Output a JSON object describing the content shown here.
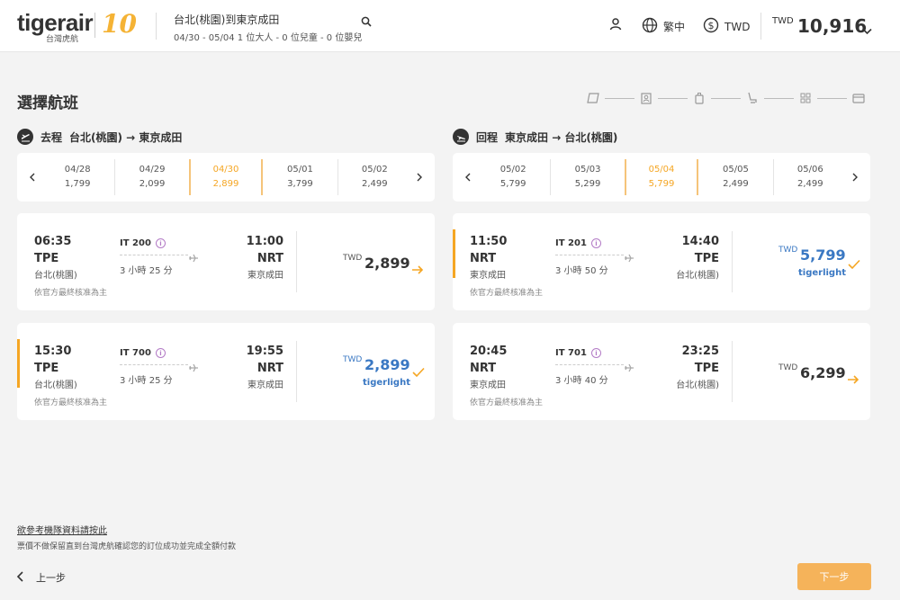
{
  "header": {
    "logo_text": "tigerair",
    "logo_sub": "台灣虎航",
    "logo_badge": "10",
    "route_title": "台北(桃園)到東京成田",
    "route_sub": "04/30 - 05/04   1 位大人 - 0 位兒童 - 0 位嬰兒",
    "language": "繁中",
    "currency": "TWD",
    "total_currency": "TWD",
    "total_amount": "10,916"
  },
  "page": {
    "title": "選擇航班"
  },
  "outbound": {
    "label": "去程",
    "route": "台北(桃園) → 東京成田",
    "dates": [
      {
        "date": "04/28",
        "price": "1,799"
      },
      {
        "date": "04/29",
        "price": "2,099"
      },
      {
        "date": "04/30",
        "price": "2,899"
      },
      {
        "date": "05/01",
        "price": "3,799"
      },
      {
        "date": "05/02",
        "price": "2,499"
      }
    ],
    "flights": [
      {
        "dep_time": "06:35",
        "dep_code": "TPE",
        "dep_city": "台北(桃園)",
        "flight_no": "IT 200",
        "duration": "3 小時 25 分",
        "arr_time": "11:00",
        "arr_code": "NRT",
        "arr_city": "東京成田",
        "note": "依官方最終核准為主",
        "currency": "TWD",
        "price": "2,899",
        "tier": ""
      },
      {
        "dep_time": "15:30",
        "dep_code": "TPE",
        "dep_city": "台北(桃園)",
        "flight_no": "IT 700",
        "duration": "3 小時 25 分",
        "arr_time": "19:55",
        "arr_code": "NRT",
        "arr_city": "東京成田",
        "note": "依官方最終核准為主",
        "currency": "TWD",
        "price": "2,899",
        "tier": "tigerlight"
      }
    ]
  },
  "inbound": {
    "label": "回程",
    "route": "東京成田 → 台北(桃園)",
    "dates": [
      {
        "date": "05/02",
        "price": "5,799"
      },
      {
        "date": "05/03",
        "price": "5,299"
      },
      {
        "date": "05/04",
        "price": "5,799"
      },
      {
        "date": "05/05",
        "price": "2,499"
      },
      {
        "date": "05/06",
        "price": "2,499"
      }
    ],
    "flights": [
      {
        "dep_time": "11:50",
        "dep_code": "NRT",
        "dep_city": "東京成田",
        "flight_no": "IT 201",
        "duration": "3 小時 50 分",
        "arr_time": "14:40",
        "arr_code": "TPE",
        "arr_city": "台北(桃園)",
        "note": "依官方最終核准為主",
        "currency": "TWD",
        "price": "5,799",
        "tier": "tigerlight"
      },
      {
        "dep_time": "20:45",
        "dep_code": "NRT",
        "dep_city": "東京成田",
        "flight_no": "IT 701",
        "duration": "3 小時 40 分",
        "arr_time": "23:25",
        "arr_code": "TPE",
        "arr_city": "台北(桃園)",
        "note": "依官方最終核准為主",
        "currency": "TWD",
        "price": "6,299",
        "tier": ""
      }
    ]
  },
  "footer": {
    "ref_link": "欲參考機隊資料請按此",
    "disclaimer": "票價不做保留直到台灣虎航確認您的訂位成功並完成全額付款",
    "back": "上一步",
    "next": "下一步"
  },
  "colors": {
    "accent": "#f5a623",
    "price_blue": "#3a78c3",
    "next_button": "#f5b35a"
  },
  "icons": [
    "search-icon",
    "user-icon",
    "globe-icon",
    "dollar-icon",
    "chevron-down-icon",
    "plane-icon",
    "arrow-right-icon",
    "check-icon",
    "info-icon",
    "chevron-left-icon",
    "chevron-right-icon"
  ]
}
